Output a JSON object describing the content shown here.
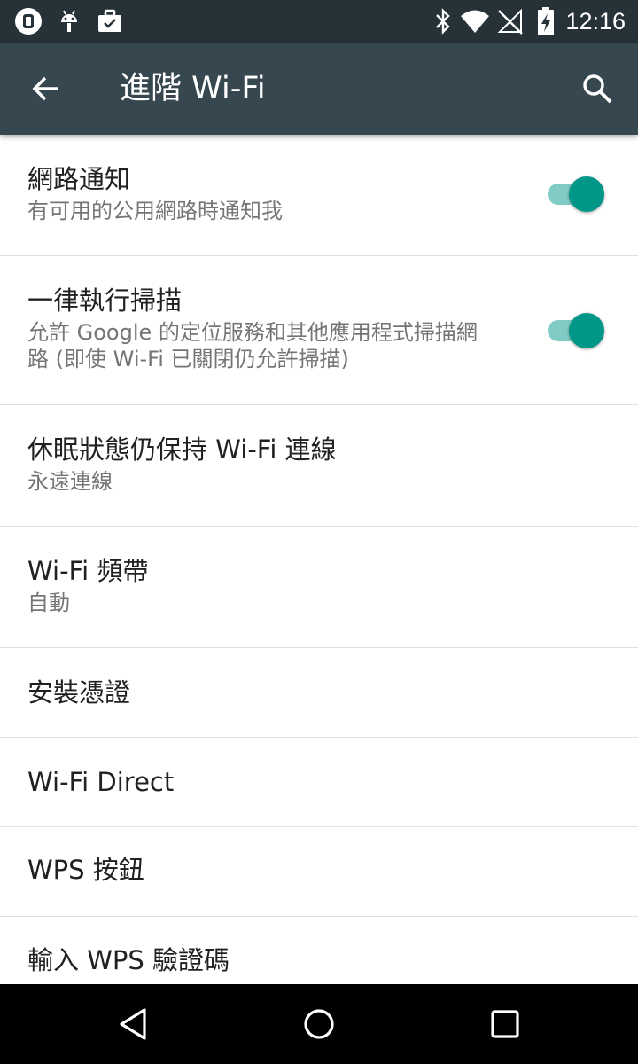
{
  "status_bar": {
    "time": "12:16",
    "left_icons": [
      "watch-icon",
      "android-icon",
      "briefcase-icon"
    ],
    "right_icons": [
      "bluetooth-icon",
      "wifi-icon",
      "no-sim-icon",
      "battery-charging-icon"
    ]
  },
  "app_bar": {
    "title": "進階 Wi-Fi",
    "back_icon": "arrow-back-icon",
    "search_icon": "search-icon"
  },
  "settings": {
    "items": [
      {
        "title": "網路通知",
        "summary": "有可用的公用網路時通知我",
        "toggle": true
      },
      {
        "title": "一律執行掃描",
        "summary": "允許 Google 的定位服務和其他應用程式掃描網路 (即使 Wi-Fi 已關閉仍允許掃描)",
        "toggle": true
      },
      {
        "title": "休眠狀態仍保持 Wi-Fi 連線",
        "summary": "永遠連線"
      },
      {
        "title": "Wi-Fi 頻帶",
        "summary": "自動"
      },
      {
        "title": "安裝憑證"
      },
      {
        "title": "Wi-Fi Direct"
      },
      {
        "title": "WPS 按鈕"
      },
      {
        "title": "輸入 WPS 驗證碼"
      }
    ]
  },
  "nav_bar": {
    "buttons": [
      "back-triangle-icon",
      "home-circle-icon",
      "recents-square-icon"
    ]
  },
  "colors": {
    "status_bar": "#263238",
    "app_bar": "#37474f",
    "accent": "#009688",
    "accent_track": "#80cbc4",
    "primary_text": "#212121",
    "secondary_text": "#757575",
    "divider": "#e0e0e0",
    "nav_bar": "#000000"
  }
}
